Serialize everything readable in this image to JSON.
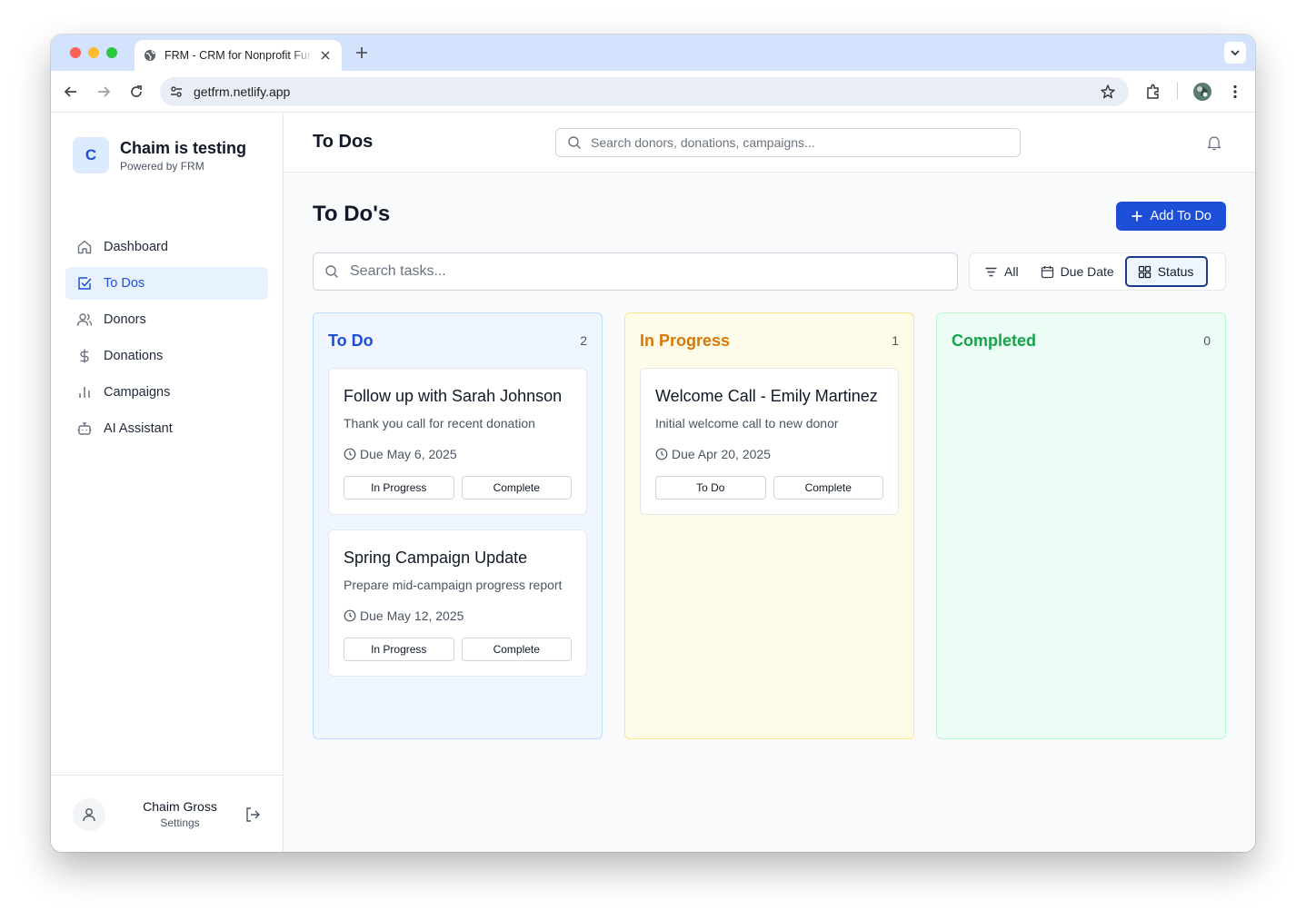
{
  "browser": {
    "tab_title": "FRM - CRM for Nonprofit Fundraising",
    "url": "getfrm.netlify.app"
  },
  "sidebar": {
    "org_initial": "C",
    "org_name": "Chaim is testing",
    "org_sub": "Powered by FRM",
    "items": [
      {
        "label": "Dashboard",
        "icon": "home-icon"
      },
      {
        "label": "To Dos",
        "icon": "checkbox-icon",
        "active": true
      },
      {
        "label": "Donors",
        "icon": "users-icon"
      },
      {
        "label": "Donations",
        "icon": "dollar-icon"
      },
      {
        "label": "Campaigns",
        "icon": "bar-chart-icon"
      },
      {
        "label": "AI Assistant",
        "icon": "bot-icon"
      }
    ],
    "user": {
      "name": "Chaim Gross",
      "settings": "Settings"
    }
  },
  "topbar": {
    "title": "To Dos",
    "search_placeholder": "Search donors, donations, campaigns..."
  },
  "page": {
    "title": "To Do's",
    "add_button": "Add To Do",
    "task_search_placeholder": "Search tasks...",
    "filters": [
      {
        "label": "All",
        "icon": "filter-icon"
      },
      {
        "label": "Due Date",
        "icon": "calendar-icon"
      },
      {
        "label": "Status",
        "icon": "grid-icon",
        "active": true
      }
    ]
  },
  "columns": [
    {
      "title": "To Do",
      "count": "2",
      "color": "#1d4ed8",
      "cards": [
        {
          "title": "Follow up with Sarah Johnson",
          "desc": "Thank you call for recent donation",
          "due": "Due May 6, 2025",
          "actions": [
            "In Progress",
            "Complete"
          ]
        },
        {
          "title": "Spring Campaign Update",
          "desc": "Prepare mid-campaign progress report",
          "due": "Due May 12, 2025",
          "actions": [
            "In Progress",
            "Complete"
          ]
        }
      ]
    },
    {
      "title": "In Progress",
      "count": "1",
      "color": "#d97706",
      "cards": [
        {
          "title": "Welcome Call - Emily Martinez",
          "desc": "Initial welcome call to new donor",
          "due": "Due Apr 20, 2025",
          "actions": [
            "To Do",
            "Complete"
          ]
        }
      ]
    },
    {
      "title": "Completed",
      "count": "0",
      "color": "#16a34a",
      "cards": []
    }
  ]
}
